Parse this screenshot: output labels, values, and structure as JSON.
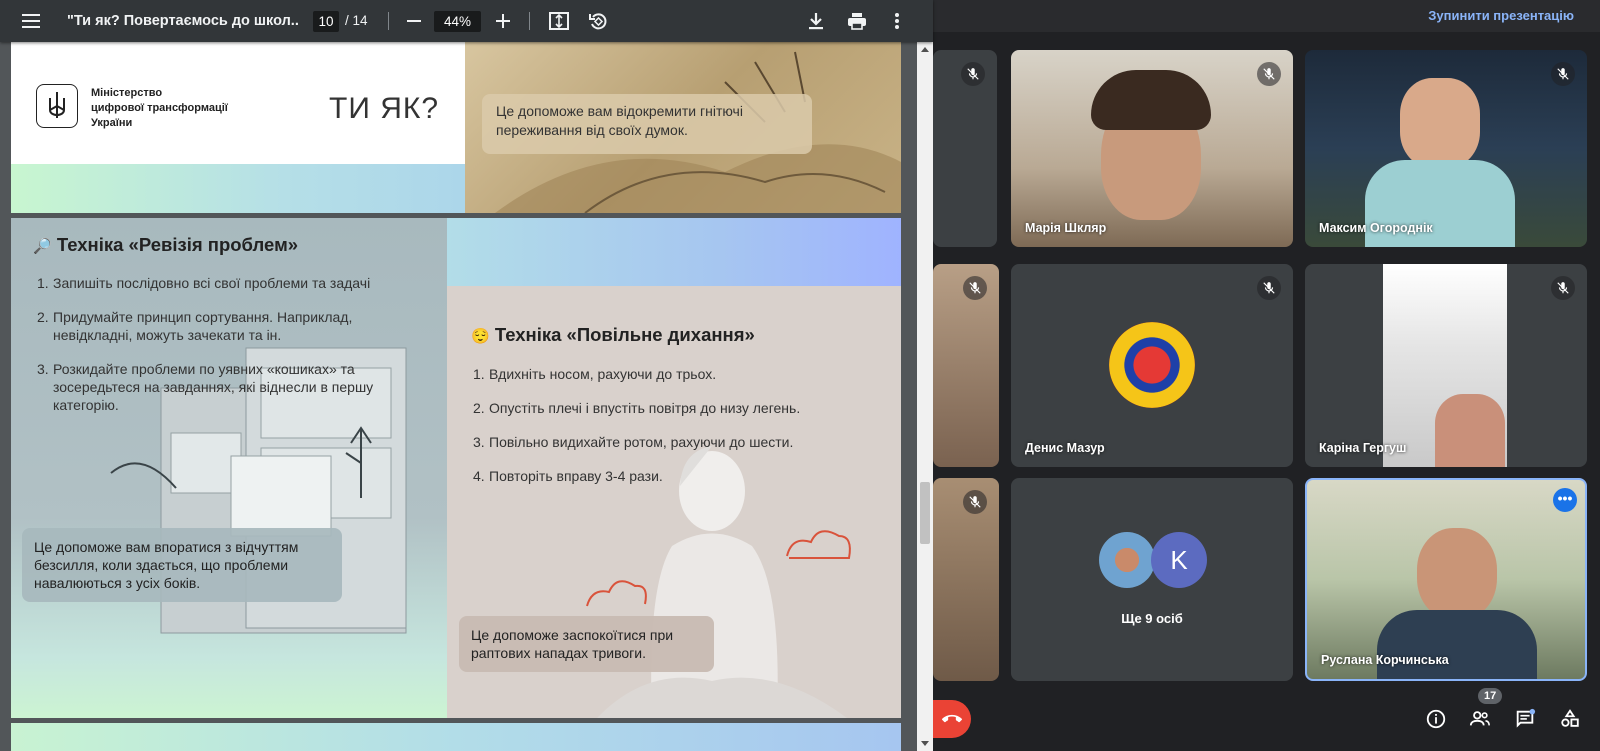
{
  "pdf_viewer": {
    "title": "\"Ти як? Повертаємось до школ...",
    "current_page": "10",
    "total_pages": "/ 14",
    "zoom": "44%",
    "icons": [
      "menu-icon",
      "zoom-out-icon",
      "zoom-in-icon",
      "fit-page-icon",
      "rotate-icon",
      "download-icon",
      "print-icon",
      "more-vert-icon"
    ]
  },
  "slide9": {
    "ministry_name": "Міністерство\nцифрової трансформації\nУкраїни",
    "brand_logo": "ТИ ЯК?",
    "callout": "Це допоможе вам відокремити гнітючі переживання від своїх думок."
  },
  "slide10": {
    "tech1": {
      "emoji": "🔎",
      "title": "Техніка «Ревізія проблем»",
      "items": [
        "Запишіть послідовно всі свої проблеми та задачі",
        "Придумайте принцип сортування. Наприклад, невідкладні, можуть зачекати та ін.",
        "Розкидайте проблеми по уявних «кошиках» та зосередьтеся на завданнях, які віднесли в першу категорію."
      ],
      "callout": "Це допоможе вам впоратися з відчуттям безсилля, коли здається, що проблеми навалюються з усіх боків."
    },
    "tech2": {
      "emoji": "😌",
      "title": "Техніка «Повільне дихання»",
      "items": [
        "Вдихніть носом, рахуючи до трьох.",
        "Опустіть плечі і впустіть повітря до низу легень.",
        "Повільно видихайте ротом, рахуючи до шести.",
        "Повторіть вправу 3-4 рази."
      ],
      "callout": "Це допоможе заспокоїтися при раптових нападах тривоги."
    }
  },
  "meet": {
    "stop_presentation": "Зупинити презентацію",
    "participants": [
      {
        "name": "Марія Шкляр"
      },
      {
        "name": "Максим Огороднік"
      },
      {
        "name": "Денис Мазур"
      },
      {
        "name": "Каріна Гергуш"
      },
      {
        "name": "Ще 9 осіб",
        "avatar_letter": "K"
      },
      {
        "name": "Руслана Корчинська"
      }
    ],
    "participants_count": "17",
    "colors": {
      "accent": "#8ab4f8",
      "hangup": "#ea4335",
      "avatar_k": "#5c6bc0"
    }
  }
}
